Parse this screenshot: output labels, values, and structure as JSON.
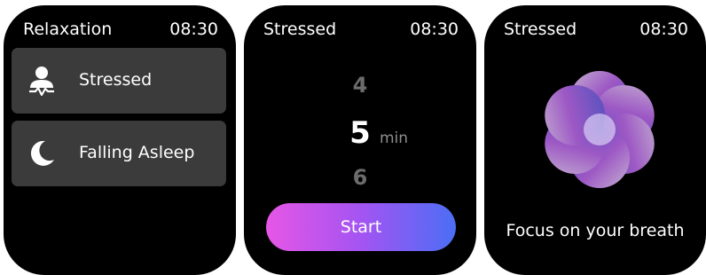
{
  "screens": [
    {
      "title": "Relaxation",
      "time": "08:30",
      "items": [
        {
          "label": "Stressed",
          "icon": "person-meditation-icon"
        },
        {
          "label": "Falling Asleep",
          "icon": "moon-icon"
        }
      ]
    },
    {
      "title": "Stressed",
      "time": "08:30",
      "picker": {
        "prev": "4",
        "current": "5",
        "unit": "min",
        "next": "6"
      },
      "start_label": "Start"
    },
    {
      "title": "Stressed",
      "time": "08:30",
      "visual_icon": "breathing-flower-icon",
      "caption": "Focus on your breath"
    }
  ],
  "colors": {
    "card": "#3b3b3b",
    "gradient_start": "#e656e6",
    "gradient_end": "#4b6ef5",
    "dim_number": "#6c6c6c"
  }
}
